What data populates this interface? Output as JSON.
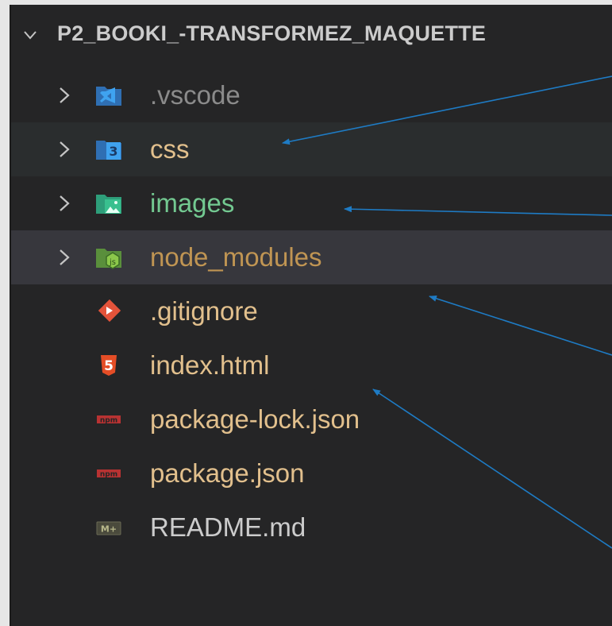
{
  "explorer": {
    "folder_title": "P2_BOOKI_-TRANSFORMEZ_MAQUETTE",
    "items": [
      {
        "label": ".vscode",
        "type": "folder",
        "icon": "vscode-folder-icon"
      },
      {
        "label": "css",
        "type": "folder",
        "icon": "css-folder-icon"
      },
      {
        "label": "images",
        "type": "folder",
        "icon": "images-folder-icon"
      },
      {
        "label": "node_modules",
        "type": "folder",
        "icon": "node-folder-icon"
      },
      {
        "label": ".gitignore",
        "type": "file",
        "icon": "git-icon"
      },
      {
        "label": "index.html",
        "type": "file",
        "icon": "html5-icon"
      },
      {
        "label": "package-lock.json",
        "type": "file",
        "icon": "npm-icon"
      },
      {
        "label": "package.json",
        "type": "file",
        "icon": "npm-icon"
      },
      {
        "label": "README.md",
        "type": "file",
        "icon": "markdown-icon"
      }
    ]
  },
  "colors": {
    "background": "#252526",
    "selected_row": "#2a2d2e",
    "hover_row": "#37373d",
    "arrow": "#1e7bc4"
  }
}
